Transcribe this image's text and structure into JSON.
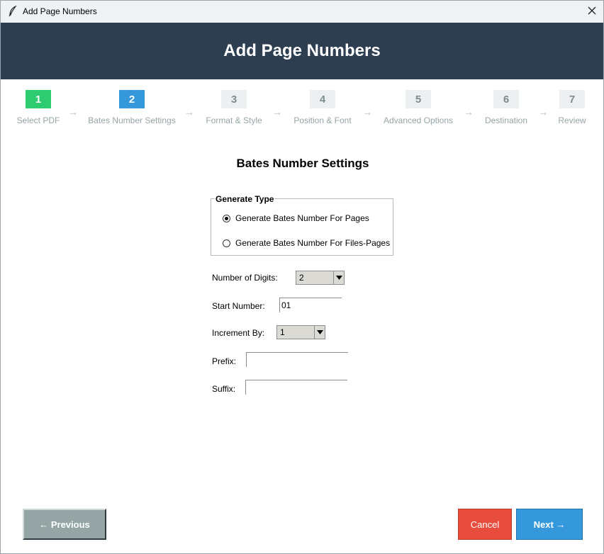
{
  "window": {
    "title": "Add Page Numbers",
    "app_icon": "feather-icon",
    "close_icon": "close-icon"
  },
  "header": {
    "title": "Add Page Numbers"
  },
  "steps": [
    {
      "num": "1",
      "label": "Select PDF",
      "state": "done"
    },
    {
      "num": "2",
      "label": "Bates Number Settings",
      "state": "active"
    },
    {
      "num": "3",
      "label": "Format & Style",
      "state": "pending"
    },
    {
      "num": "4",
      "label": "Position & Font",
      "state": "pending"
    },
    {
      "num": "5",
      "label": "Advanced Options",
      "state": "pending"
    },
    {
      "num": "6",
      "label": "Destination",
      "state": "pending"
    },
    {
      "num": "7",
      "label": "Review",
      "state": "pending"
    }
  ],
  "step_arrow": "→",
  "section": {
    "title": "Bates Number Settings"
  },
  "generate_type": {
    "legend": "Generate Type",
    "options": [
      {
        "label": "Generate Bates Number For Pages",
        "selected": true
      },
      {
        "label": "Generate Bates Number For Files-Pages",
        "selected": false
      }
    ]
  },
  "fields": {
    "digits": {
      "label": "Number of Digits:",
      "value": "2"
    },
    "start": {
      "label": "Start Number:",
      "value": "01"
    },
    "increment": {
      "label": "Increment By:",
      "value": "1"
    },
    "prefix": {
      "label": "Prefix:",
      "value": ""
    },
    "suffix": {
      "label": "Suffix:",
      "value": ""
    }
  },
  "buttons": {
    "previous": "← Previous",
    "cancel": "Cancel",
    "next": "Next →"
  },
  "colors": {
    "header_bg": "#2c3e50",
    "step_done": "#2ecc71",
    "step_active": "#3498db",
    "step_pending": "#ecf0f1",
    "previous_bg": "#95a5a6",
    "cancel_bg": "#e74c3c",
    "next_bg": "#3498db"
  }
}
